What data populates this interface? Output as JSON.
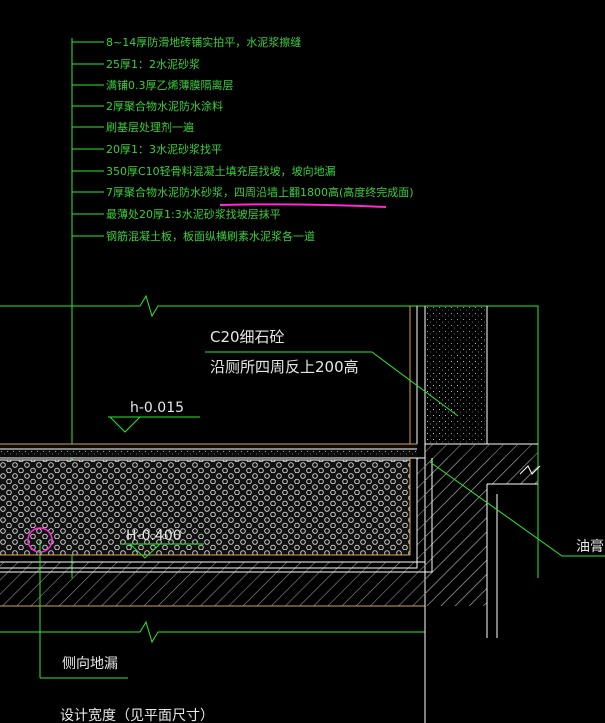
{
  "drawing": {
    "layers_notes": [
      "8~14厚防滑地砖铺实拍平，水泥浆擦缝",
      "25厚1：2水泥砂浆",
      "满铺0.3厚乙烯薄膜隔离层",
      "2厚聚合物水泥防水涂料",
      "刷基层处理剂一遍",
      "20厚1：3水泥砂浆找平",
      "350厚C10轻骨料混凝土填充层找坡，坡向地漏",
      "7厚聚合物水泥防水砂浆，四周沿墙上翻1800高(高度终完成面)",
      "最薄处20厚1:3水泥砂浆找坡层抹平",
      "钢筋混凝土板，板面纵横刷素水泥浆各一道"
    ],
    "labels": {
      "c20_line1": "C20细石砼",
      "c20_line2": "沿厕所四周反上200高",
      "elev_top": "h-0.015",
      "elev_bottom": "H-0.400",
      "side_drain": "侧向地漏",
      "design_width": "设计宽度（见平面尺寸）",
      "grease": "油膏"
    },
    "colors": {
      "background": "#000000",
      "note_text": "#3ccf3c",
      "leader": "#2ee82e",
      "label_text": "#e6e6e6",
      "wall_line": "#ffffff",
      "finish_line": "#d9a24a",
      "insulation": "#e0e0e0",
      "hatch": "#bdbdbd",
      "drain": "#ff2ad4",
      "highlight": "#ff2ad4"
    }
  }
}
